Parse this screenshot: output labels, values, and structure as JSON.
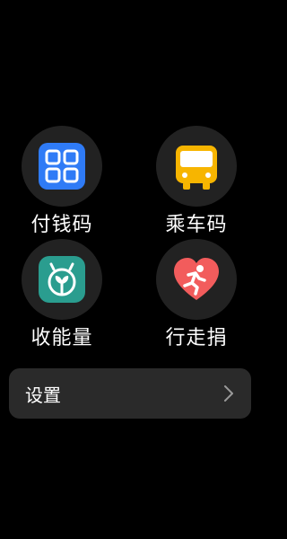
{
  "tiles": [
    {
      "label": "付钱码",
      "icon": "qr-code-icon",
      "color": "#2f7bf6"
    },
    {
      "label": "乘车码",
      "icon": "bus-icon",
      "color": "#f7b500"
    },
    {
      "label": "收能量",
      "icon": "sprout-icon",
      "color": "#2a9d8f"
    },
    {
      "label": "行走捐",
      "icon": "heart-runner-icon",
      "color": "#f25c5c"
    }
  ],
  "settings": {
    "label": "设置",
    "icon": "chevron-right-icon"
  }
}
